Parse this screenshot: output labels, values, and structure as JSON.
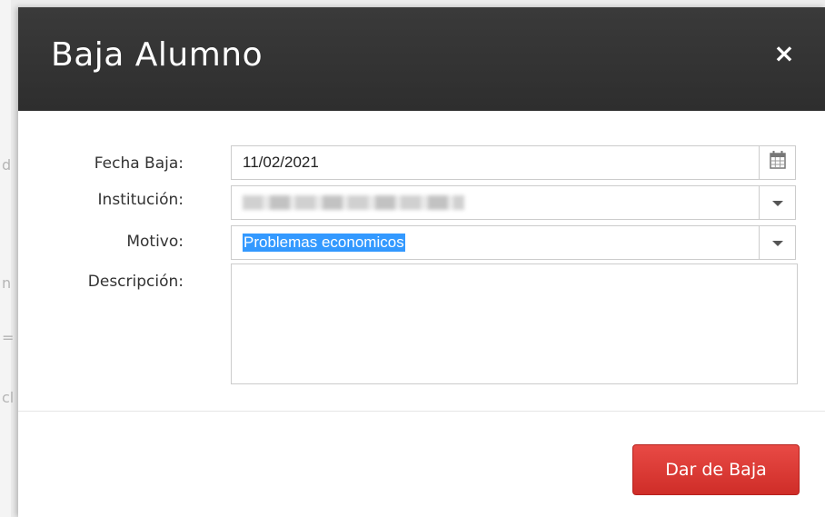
{
  "modal": {
    "title": "Baja Alumno",
    "close_icon": "close-icon"
  },
  "form": {
    "fecha_baja": {
      "label": "Fecha Baja:",
      "value": "11/02/2021",
      "icon": "calendar-icon"
    },
    "institucion": {
      "label": "Institución:",
      "value_state": "redacted",
      "icon": "chevron-down-icon"
    },
    "motivo": {
      "label": "Motivo:",
      "value": "Problemas economicos",
      "icon": "chevron-down-icon"
    },
    "descripcion": {
      "label": "Descripción:",
      "value": ""
    }
  },
  "footer": {
    "submit_label": "Dar de Baja"
  },
  "colors": {
    "header_bg": "#333333",
    "primary_button": "#dc3530",
    "selection": "#3399ff"
  }
}
